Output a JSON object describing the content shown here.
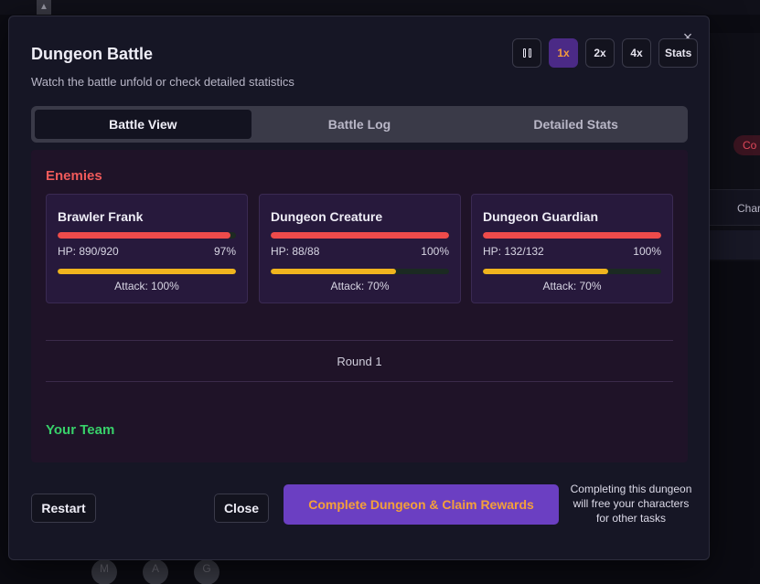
{
  "background": {
    "chip_text": "Co",
    "row_text": "Char",
    "avatars": [
      "M",
      "A",
      "G"
    ]
  },
  "modal": {
    "title": "Dungeon Battle",
    "subtitle": "Watch the battle unfold or check detailed statistics",
    "close_icon": "close-icon",
    "controls": {
      "pause_icon": "pause-icon",
      "speeds": [
        "1x",
        "2x",
        "4x"
      ],
      "active_speed": "1x",
      "stats_label": "Stats"
    },
    "tabs": [
      {
        "label": "Battle View",
        "active": true
      },
      {
        "label": "Battle Log",
        "active": false
      },
      {
        "label": "Detailed Stats",
        "active": false
      }
    ],
    "battle": {
      "enemies_title": "Enemies",
      "enemies": [
        {
          "name": "Brawler Frank",
          "hp_text": "HP: 890/920",
          "hp_pct_text": "97%",
          "hp_fraction": 0.97,
          "attack_text": "Attack: 100%",
          "attack_fraction": 1.0
        },
        {
          "name": "Dungeon Creature",
          "hp_text": "HP: 88/88",
          "hp_pct_text": "100%",
          "hp_fraction": 1.0,
          "attack_text": "Attack: 70%",
          "attack_fraction": 0.7
        },
        {
          "name": "Dungeon Guardian",
          "hp_text": "HP: 132/132",
          "hp_pct_text": "100%",
          "hp_fraction": 1.0,
          "attack_text": "Attack: 70%",
          "attack_fraction": 0.7
        }
      ],
      "round_label": "Round 1",
      "team_title": "Your Team"
    },
    "footer": {
      "restart_label": "Restart",
      "close_label": "Close",
      "complete_label": "Complete Dungeon & Claim Rewards",
      "complete_note": "Completing this dungeon will free your characters for other tasks"
    },
    "colors": {
      "accent_purple": "#6b3fc2",
      "accent_orange": "#f4a03a",
      "hp_red": "#ee4b4b",
      "attack_yellow": "#f0b41e",
      "enemies_title": "#f05a5a",
      "team_title": "#38d16a"
    }
  }
}
